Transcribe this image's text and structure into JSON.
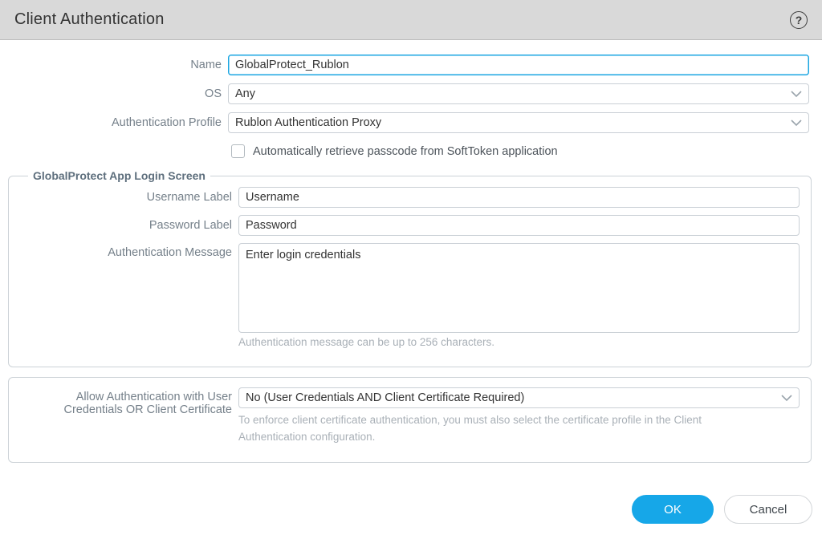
{
  "header": {
    "title": "Client Authentication",
    "help_glyph": "?"
  },
  "form": {
    "name": {
      "label": "Name",
      "value": "GlobalProtect_Rublon"
    },
    "os": {
      "label": "OS",
      "value": "Any"
    },
    "auth_profile": {
      "label": "Authentication Profile",
      "value": "Rublon Authentication Proxy"
    },
    "softtoken_checkbox": {
      "label": "Automatically retrieve passcode from SoftToken application",
      "checked": false
    }
  },
  "login_screen": {
    "legend": "GlobalProtect App Login Screen",
    "username": {
      "label": "Username Label",
      "value": "Username"
    },
    "password": {
      "label": "Password Label",
      "value": "Password"
    },
    "auth_message": {
      "label": "Authentication Message",
      "value": "Enter login credentials",
      "hint": "Authentication message can be up to 256 characters."
    }
  },
  "cert_section": {
    "label": "Allow Authentication with User Credentials OR Client Certificate",
    "value": "No (User Credentials AND Client Certificate Required)",
    "hint": "To enforce client certificate authentication, you must also select the certificate profile in the Client Authentication configuration."
  },
  "footer": {
    "ok_label": "OK",
    "cancel_label": "Cancel"
  },
  "colors": {
    "accent_blue": "#16a7e8",
    "focus_border": "#1ba6e2",
    "header_bg": "#d9d9d9"
  }
}
